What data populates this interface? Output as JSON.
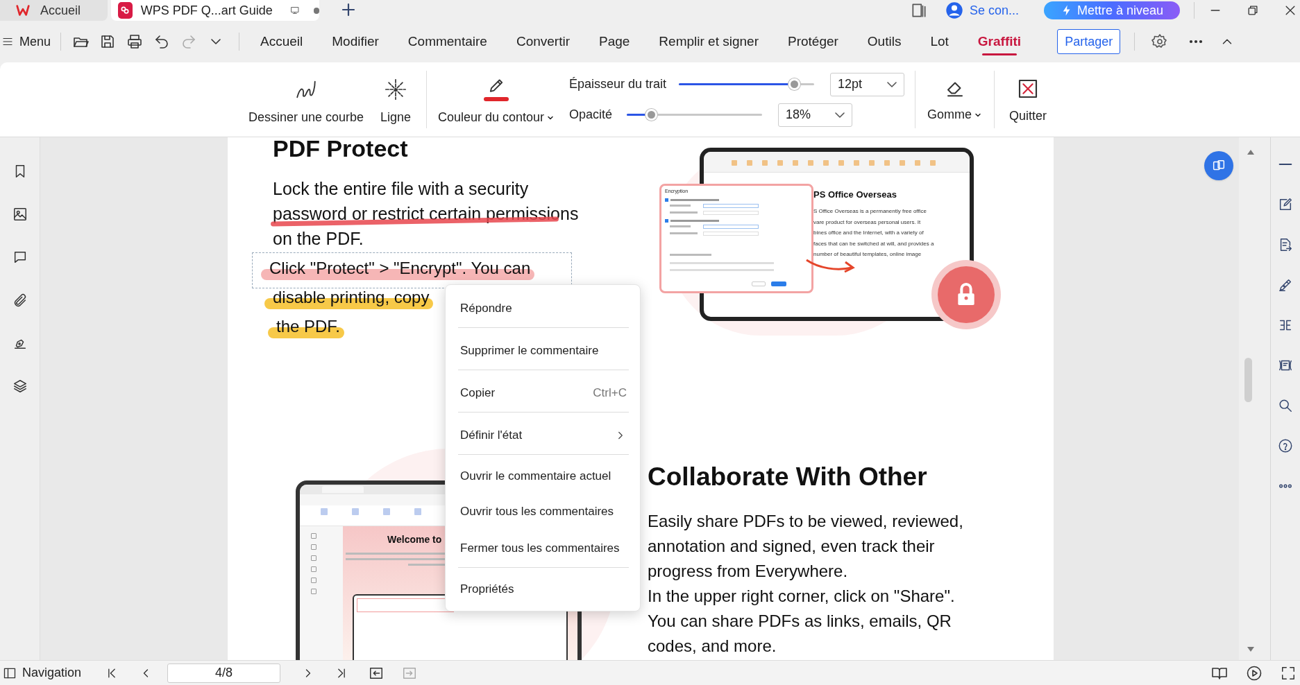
{
  "title_tabs": [
    {
      "label": "Accueil",
      "selected": false,
      "kind": "home"
    },
    {
      "label": "WPS PDF Q...art Guide",
      "selected": true,
      "kind": "pdf"
    }
  ],
  "account": {
    "label": "Se con..."
  },
  "upgrade_button": {
    "label": "Mettre à niveau"
  },
  "menu_button": {
    "label": "Menu"
  },
  "ribbon_tabs": [
    {
      "label": "Accueil",
      "selected": false
    },
    {
      "label": "Modifier",
      "selected": false
    },
    {
      "label": "Commentaire",
      "selected": false
    },
    {
      "label": "Convertir",
      "selected": false
    },
    {
      "label": "Page",
      "selected": false
    },
    {
      "label": "Remplir et signer",
      "selected": false
    },
    {
      "label": "Protéger",
      "selected": false
    },
    {
      "label": "Outils",
      "selected": false
    },
    {
      "label": "Lot",
      "selected": false
    },
    {
      "label": "Graffiti",
      "selected": true
    }
  ],
  "share_button": {
    "label": "Partager"
  },
  "draw_tools": [
    {
      "kind": "curve",
      "label": "Dessiner une courbe"
    },
    {
      "kind": "line",
      "label": "Ligne"
    }
  ],
  "contour": {
    "label": "Couleur du contour",
    "color": "#e0262b"
  },
  "thickness": {
    "label": "Épaisseur du trait",
    "level": 0.85,
    "value": "12pt"
  },
  "opacity": {
    "label": "Opacité",
    "level": 0.18,
    "value": "18%"
  },
  "eraser": {
    "label": "Gomme"
  },
  "quit": {
    "label": "Quitter"
  },
  "document": {
    "heading": "PDF Protect",
    "intro_lines": [
      "Lock the entire file with a security",
      "password or restrict certain permissions",
      "on the PDF."
    ],
    "comment_lines": [
      {
        "text": "Click \"Protect\" > \"Encrypt\". You can",
        "color": "#f6b6b6"
      },
      {
        "text": "disable printing, copy",
        "color": "#f7c948"
      },
      {
        "text": "the PDF.",
        "color": "#f7c948"
      }
    ],
    "encryption_image": {
      "dialog_title": "Encryption",
      "heading": "PS Office Overseas",
      "lines": [
        "S Office Overseas is a permanently free office",
        "vare product for overseas personal users. It",
        "bines office and the Internet, with a variety of",
        "faces that can be switched at will, and provides a",
        "number of beautiful templates, online image"
      ]
    },
    "welcome_image": {
      "title": "Welcome to"
    },
    "collab_heading": "Collaborate With Other",
    "collab_paragraphs": [
      [
        "Easily share PDFs to be viewed, reviewed,",
        "annotation and signed, even track their",
        "progress from Everywhere."
      ],
      [
        "In the upper right corner, click on \"Share\".",
        "You can share PDFs as links, emails, QR",
        "codes, and more."
      ]
    ]
  },
  "context_menu": [
    {
      "label": "Répondre",
      "submenu": false,
      "separator_after": true
    },
    {
      "label": "Supprimer le commentaire",
      "submenu": false,
      "separator_after": true
    },
    {
      "label": "Copier",
      "shortcut": "Ctrl+C",
      "submenu": false,
      "separator_after": true
    },
    {
      "label": "Définir l'état",
      "submenu": true,
      "separator_after": true
    },
    {
      "label": "Ouvrir le commentaire actuel",
      "submenu": false,
      "separator_after": false
    },
    {
      "label": "Ouvrir tous les commentaires",
      "submenu": false,
      "separator_after": false
    },
    {
      "label": "Fermer tous les commentaires",
      "submenu": false,
      "separator_after": true
    },
    {
      "label": "Propriétés",
      "submenu": false,
      "separator_after": false
    }
  ],
  "navigation": {
    "label": "Navigation",
    "page": "4/8"
  }
}
